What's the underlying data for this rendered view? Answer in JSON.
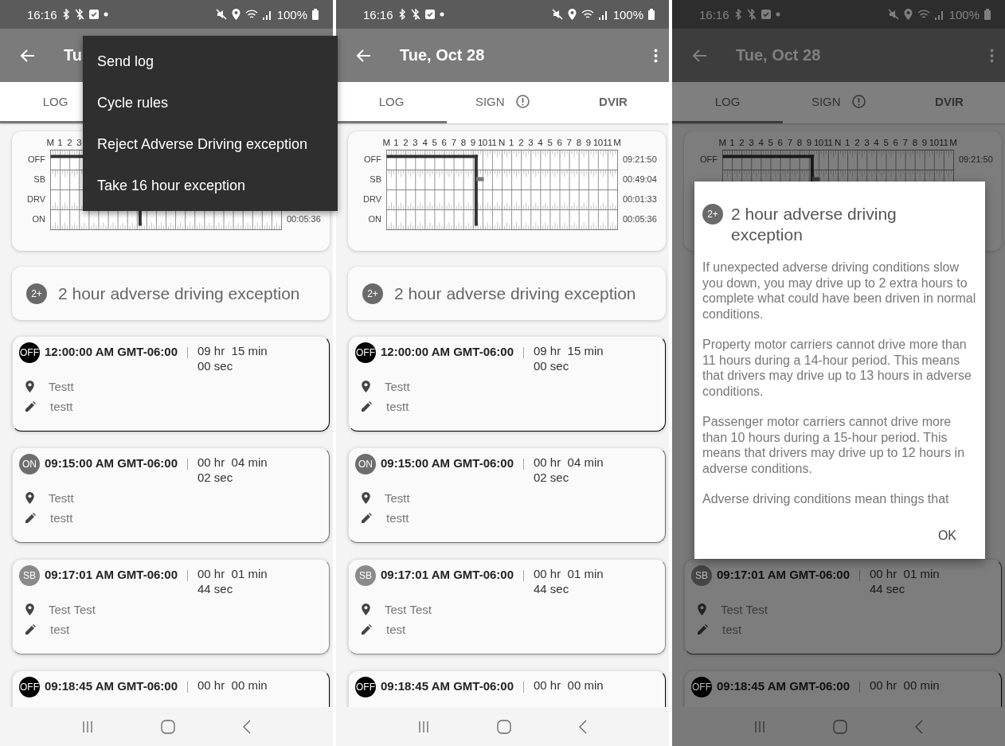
{
  "screens": [
    {
      "status_bar": {
        "time": "16:16",
        "battery": "100%"
      },
      "app_bar": {
        "title": "Tu"
      },
      "tabs": [
        {
          "label": "LOG",
          "selected": true,
          "alert": false
        }
      ],
      "chart": {
        "hours": [
          "M",
          "1",
          "2",
          "3"
        ],
        "rows": [
          {
            "label": "OFF"
          },
          {
            "label": "SB"
          },
          {
            "label": "DRV"
          },
          {
            "label": "ON",
            "reading": "00:05:36"
          }
        ]
      },
      "exception": {
        "badge": "2+",
        "label": "2 hour adverse driving exception"
      },
      "logs": [
        {
          "status": "OFF",
          "color": "#000000",
          "time": "12:00:00 AM GMT-06:00",
          "duration": "09 hr  15 min 00 sec",
          "location": "Testt",
          "note": "testt"
        },
        {
          "status": "ON",
          "color": "#6e6e6e",
          "time": "09:15:00 AM GMT-06:00",
          "duration": "00 hr  04 min 02 sec",
          "location": "Testt",
          "note": "testt"
        },
        {
          "status": "SB",
          "color": "#8a8a8a",
          "time": "09:17:01 AM GMT-06:00",
          "duration": "00 hr  01 min 44 sec",
          "location": "Test Test",
          "note": "test"
        },
        {
          "status": "OFF",
          "color": "#000000",
          "time": "09:18:45 AM GMT-06:00",
          "duration": "00 hr  00 min"
        }
      ],
      "menu": [
        "Send log",
        "Cycle rules",
        "Reject Adverse Driving exception",
        "Take 16 hour exception"
      ]
    },
    {
      "status_bar": {
        "time": "16:16",
        "battery": "100%"
      },
      "app_bar": {
        "title": "Tue, Oct 28"
      },
      "tabs": [
        {
          "label": "LOG",
          "selected": true,
          "alert": false
        },
        {
          "label": "SIGN",
          "selected": false,
          "alert": true
        },
        {
          "label": "DVIR",
          "selected": false,
          "alert": false
        }
      ],
      "chart": {
        "hours": [
          "M",
          "1",
          "2",
          "3",
          "4",
          "5",
          "6",
          "7",
          "8",
          "9",
          "10",
          "11",
          "N",
          "1",
          "2",
          "3",
          "4",
          "5",
          "6",
          "7",
          "8",
          "9",
          "10",
          "11",
          "M"
        ],
        "rows": [
          {
            "label": "OFF",
            "reading": "09:21:50"
          },
          {
            "label": "SB",
            "reading": "00:49:04"
          },
          {
            "label": "DRV",
            "reading": "00:01:33"
          },
          {
            "label": "ON",
            "reading": "00:05:36"
          }
        ]
      },
      "exception": {
        "badge": "2+",
        "label": "2 hour adverse driving exception"
      },
      "logs": [
        {
          "status": "OFF",
          "color": "#000000",
          "time": "12:00:00 AM GMT-06:00",
          "duration": "09 hr  15 min 00 sec",
          "location": "Testt",
          "note": "testt"
        },
        {
          "status": "ON",
          "color": "#6e6e6e",
          "time": "09:15:00 AM GMT-06:00",
          "duration": "00 hr  04 min 02 sec",
          "location": "Testt",
          "note": "testt"
        },
        {
          "status": "SB",
          "color": "#8a8a8a",
          "time": "09:17:01 AM GMT-06:00",
          "duration": "00 hr  01 min 44 sec",
          "location": "Test Test",
          "note": "test"
        },
        {
          "status": "OFF",
          "color": "#000000",
          "time": "09:18:45 AM GMT-06:00",
          "duration": "00 hr  00 min"
        }
      ]
    },
    {
      "status_bar": {
        "time": "16:16",
        "battery": "100%"
      },
      "app_bar": {
        "title": "Tue, Oct 28"
      },
      "tabs": [
        {
          "label": "LOG",
          "selected": true,
          "alert": false
        },
        {
          "label": "SIGN",
          "selected": false,
          "alert": true
        },
        {
          "label": "DVIR",
          "selected": false,
          "alert": false
        }
      ],
      "chart": {
        "hours": [
          "M",
          "1",
          "2",
          "3",
          "4",
          "5",
          "6",
          "7",
          "8",
          "9",
          "10",
          "11",
          "N",
          "1",
          "2",
          "3",
          "4",
          "5",
          "6",
          "7",
          "8",
          "9",
          "10",
          "11",
          "M"
        ],
        "rows": [
          {
            "label": "OFF",
            "reading": "09:21:50"
          }
        ]
      },
      "logs": [
        {
          "status": "SB",
          "color": "#454545",
          "time": "09:17:01 AM GMT-06:00",
          "duration": "00 hr  01 min 44 sec",
          "location": "Test Test",
          "note": "test"
        },
        {
          "status": "OFF",
          "color": "#000000",
          "time": "09:18:45 AM GMT-06:00",
          "duration": "00 hr  00 min"
        }
      ],
      "dialog": {
        "badge": "2+",
        "title": "2 hour adverse driving exception",
        "paragraphs": [
          "If unexpected adverse driving conditions slow you down, you may drive up to 2 extra hours to complete what could have been driven in normal conditions.",
          "Property motor carriers cannot drive more than 11 hours during a 14-hour period. This means that drivers may drive up to 13 hours in adverse conditions.",
          "Passenger motor carriers cannot drive more than 10 hours during a 15-hour period. This means that drivers may drive up to 12 hours in adverse conditions.",
          "Adverse driving conditions mean things that"
        ],
        "button": "OK"
      }
    }
  ]
}
